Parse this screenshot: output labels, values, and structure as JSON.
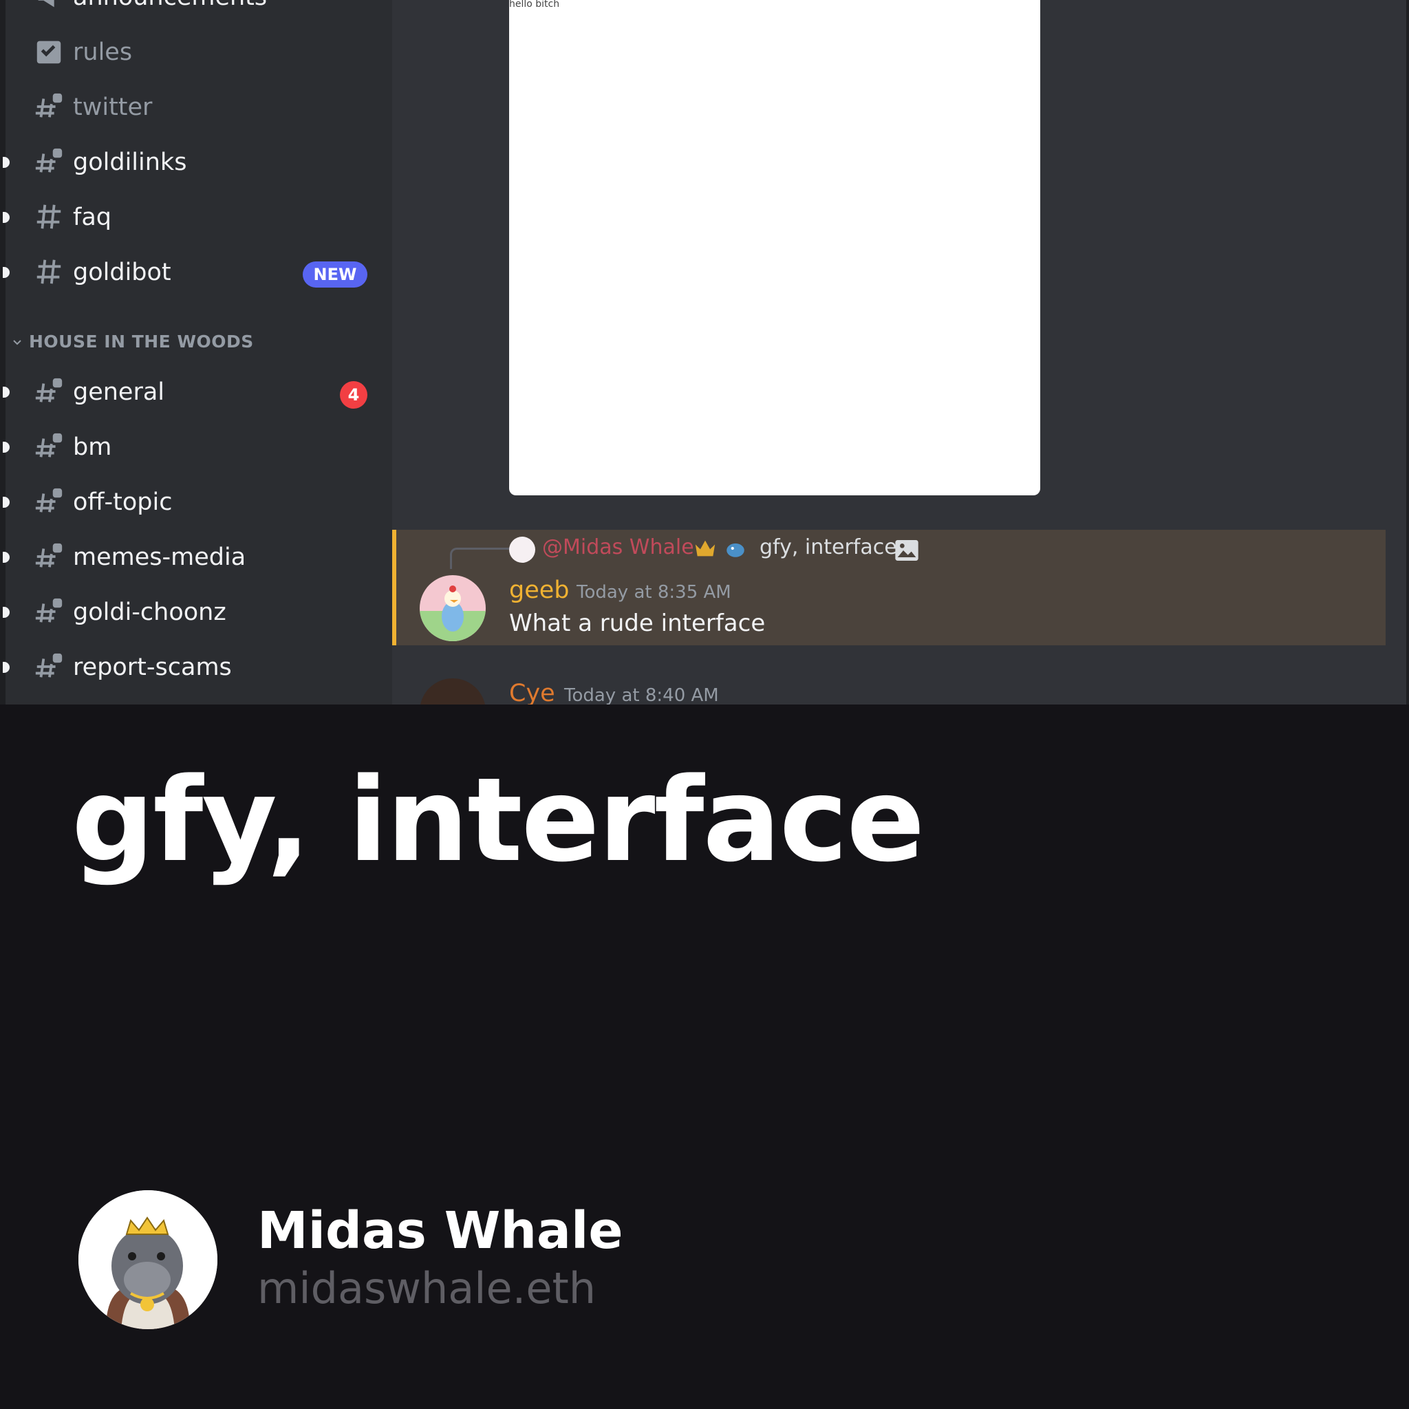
{
  "sidebar": {
    "channels_top": [
      {
        "label": "announcements",
        "icon": "announcement-icon"
      },
      {
        "label": "rules",
        "icon": "rules-icon"
      },
      {
        "label": "twitter",
        "icon": "thread-hash-icon"
      },
      {
        "label": "goldilinks",
        "icon": "thread-hash-icon"
      },
      {
        "label": "faq",
        "icon": "hash-icon"
      },
      {
        "label": "goldibot",
        "icon": "hash-icon",
        "badge": "NEW"
      }
    ],
    "category": "HOUSE IN THE WOODS",
    "channels_bottom": [
      {
        "label": "general",
        "icon": "thread-hash-icon",
        "count": "4"
      },
      {
        "label": "bm",
        "icon": "thread-hash-icon"
      },
      {
        "label": "off-topic",
        "icon": "thread-hash-icon"
      },
      {
        "label": "memes-media",
        "icon": "thread-hash-icon"
      },
      {
        "label": "goldi-choonz",
        "icon": "thread-hash-icon"
      },
      {
        "label": "report-scams",
        "icon": "thread-hash-icon"
      }
    ]
  },
  "chat": {
    "image_caption": "hello bitch",
    "reply": {
      "mention": "@Midas Whale",
      "text": "gfy, interface"
    },
    "message": {
      "author": "geeb",
      "time": "Today at 8:35 AM",
      "text": "What a rude interface"
    },
    "next_message": {
      "author": "Cye",
      "time": "Today at 8:40 AM"
    }
  },
  "card": {
    "headline": "gfy, interface",
    "author_name": "Midas Whale",
    "author_handle": "midaswhale.eth"
  },
  "colors": {
    "sidebar_bg": "#2b2d31",
    "chat_bg": "#313338",
    "highlight_bg": "#4b433c",
    "highlight_bar": "#f0b232",
    "mention": "#c04a5a",
    "badge_new": "#5865f2",
    "badge_count": "#f23f43",
    "card_bg": "#141317"
  }
}
